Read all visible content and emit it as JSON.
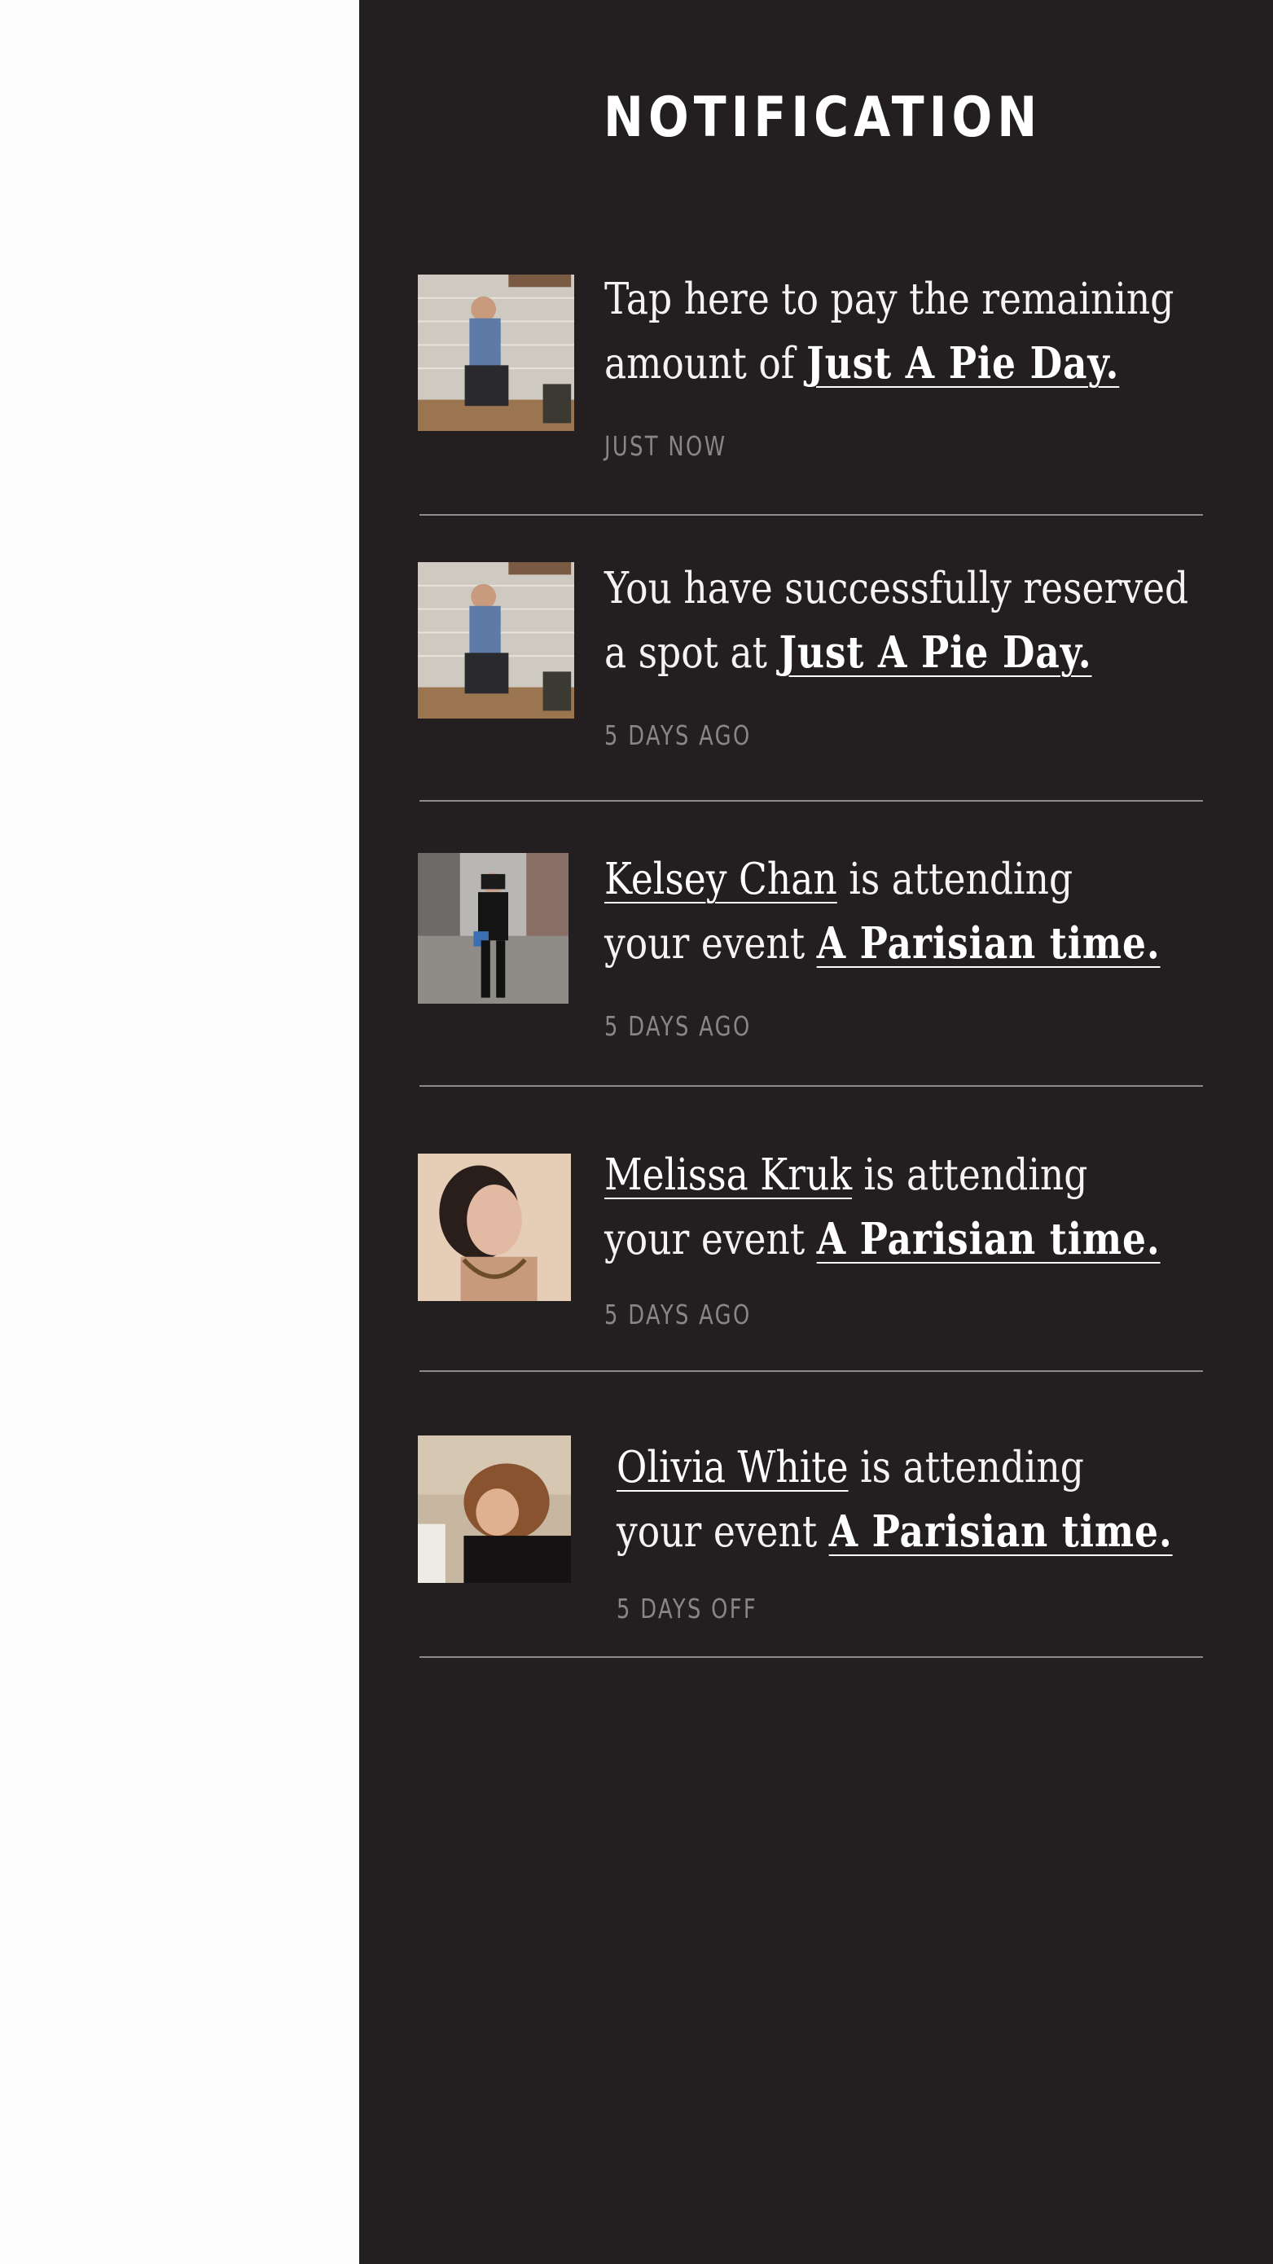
{
  "header": {
    "title": "NOTIFICATION"
  },
  "notifications": [
    {
      "avatar": "man-sitting-photo",
      "line1": "Tap here to pay the remaining",
      "line2_prefix": "amount of ",
      "link": "Just A Pie Day.",
      "time": "JUST NOW"
    },
    {
      "avatar": "man-sitting-photo",
      "line1": "You have successfully reserved",
      "line2_prefix": "a spot at ",
      "link": "Just A Pie Day.",
      "time": "5 DAYS AGO"
    },
    {
      "avatar": "woman-street-photo",
      "name": "Kelsey Chan",
      "line1_suffix": " is attending",
      "line2_prefix": "your event ",
      "link": "A Parisian time.",
      "time": "5 DAYS AGO"
    },
    {
      "avatar": "woman-portrait-photo",
      "name": "Melissa Kruk",
      "line1_suffix": " is attending",
      "line2_prefix": "your event ",
      "link": "A Parisian time.",
      "time": "5 DAYS AGO"
    },
    {
      "avatar": "woman-redhair-photo",
      "name": "Olivia White",
      "line1_suffix": " is attending",
      "line2_prefix": "your event ",
      "link": "A Parisian time.",
      "time": "5 DAYS OFF"
    }
  ]
}
